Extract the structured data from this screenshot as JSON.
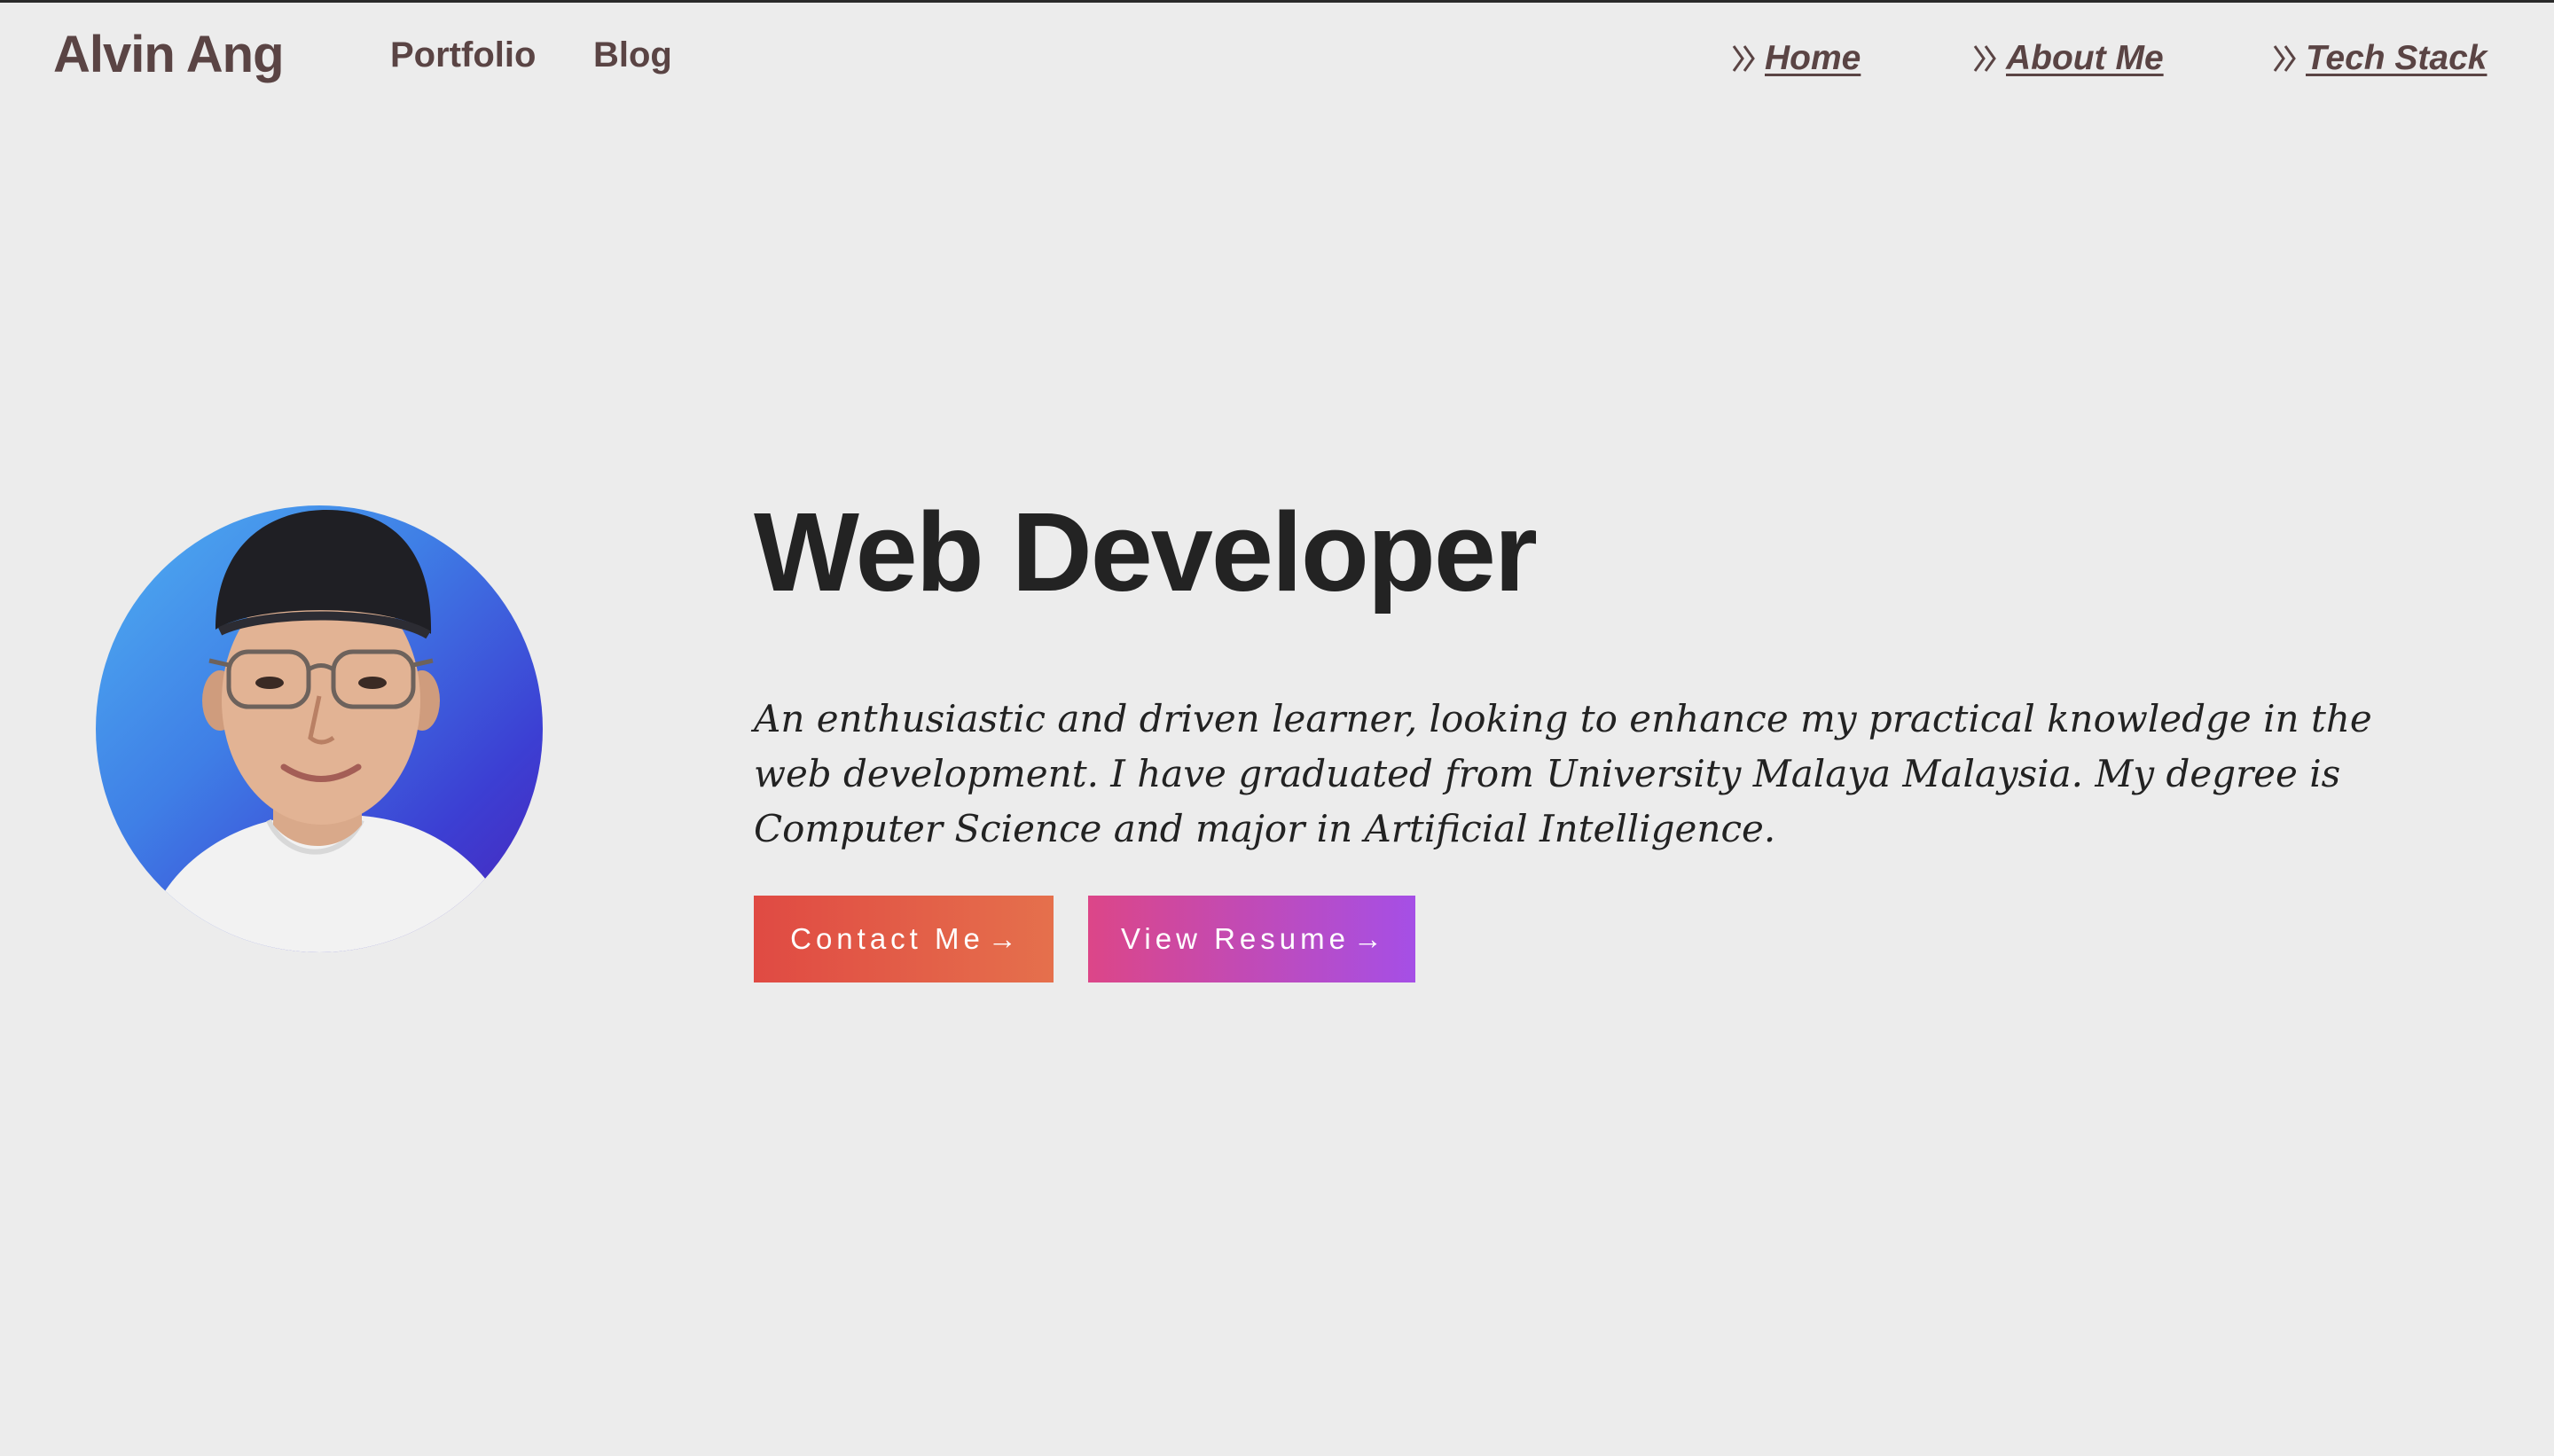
{
  "header": {
    "brand": "Alvin Ang",
    "left_nav": [
      {
        "label": "Portfolio"
      },
      {
        "label": "Blog"
      }
    ],
    "right_nav": [
      {
        "label": "Home",
        "icon": "double-chevron-right-icon"
      },
      {
        "label": "About Me",
        "icon": "double-chevron-right-icon"
      },
      {
        "label": "Tech Stack",
        "icon": "double-chevron-right-icon"
      }
    ]
  },
  "hero": {
    "title": "Web Developer",
    "description": "An enthusiastic and driven learner, looking to enhance my practical knowledge in the web development. I have graduated from University Malaya Malaysia. My degree is Computer Science and major in Artificial Intelligence.",
    "buttons": [
      {
        "label": "Contact Me",
        "arrow": "→"
      },
      {
        "label": "View Resume",
        "arrow": "→"
      }
    ]
  },
  "colors": {
    "background": "#ececec",
    "nav_text": "#5a4444",
    "contact_gradient": [
      "#e04a43",
      "#e5704c"
    ],
    "resume_gradient": [
      "#dc4688",
      "#a54fe6"
    ],
    "avatar_gradient": [
      "#4fb0f2",
      "#4a22b8"
    ]
  }
}
